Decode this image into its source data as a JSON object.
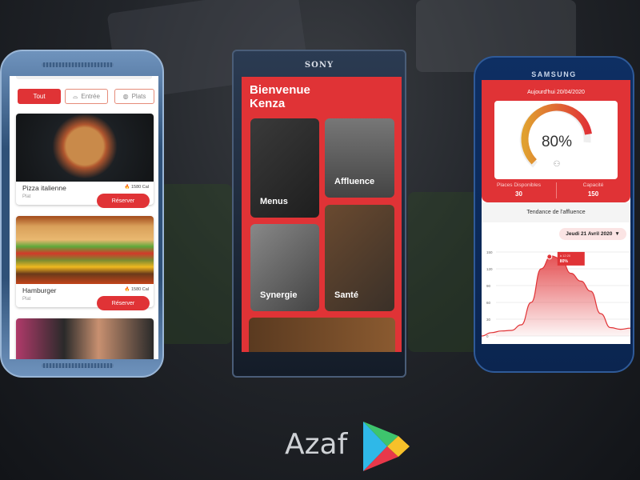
{
  "phone_menu": {
    "brand_color": "#e03336",
    "filters": [
      {
        "label": "Tout",
        "icon": "none"
      },
      {
        "label": "Entrée",
        "icon": "cloche-icon"
      },
      {
        "label": "Plats",
        "icon": "dish-icon"
      }
    ],
    "items": [
      {
        "name": "Pizza italienne",
        "category": "Plat",
        "calories": "1580 Cal",
        "action": "Réserver"
      },
      {
        "name": "Hamburger",
        "category": "Plat",
        "calories": "1580 Cal",
        "action": "Réserver"
      }
    ]
  },
  "phone_home": {
    "brand": "SONY",
    "greeting": "Bienvenue Kenza",
    "tiles": [
      {
        "label": "Menus"
      },
      {
        "label": "Affluence"
      },
      {
        "label": "Synergie"
      },
      {
        "label": "Santé"
      }
    ]
  },
  "phone_affluence": {
    "brand": "SAMSUNG",
    "date_header": "Aujourd'hui 20/04/2020",
    "gauge_value": "80%",
    "gauge_fraction": 0.8,
    "places_label": "Places Disponibles",
    "places_value": "30",
    "capacity_label": "Capacité",
    "capacity_value": "150",
    "section_title": "Tendance de l'affluence",
    "date_select": "Jeudi 21 Avril 2020",
    "tooltip_time": "à 12:20",
    "tooltip_value": "80%"
  },
  "chart_data": {
    "type": "area",
    "yticks": [
      "0",
      "30",
      "60",
      "90",
      "120",
      "150"
    ],
    "ylim": [
      0,
      150
    ],
    "values": [
      0,
      6,
      9,
      10,
      20,
      60,
      120,
      143,
      138,
      112,
      98,
      80,
      40,
      15,
      12,
      14
    ],
    "color": "#e03336"
  },
  "footer": {
    "app_name": "Azaf"
  }
}
